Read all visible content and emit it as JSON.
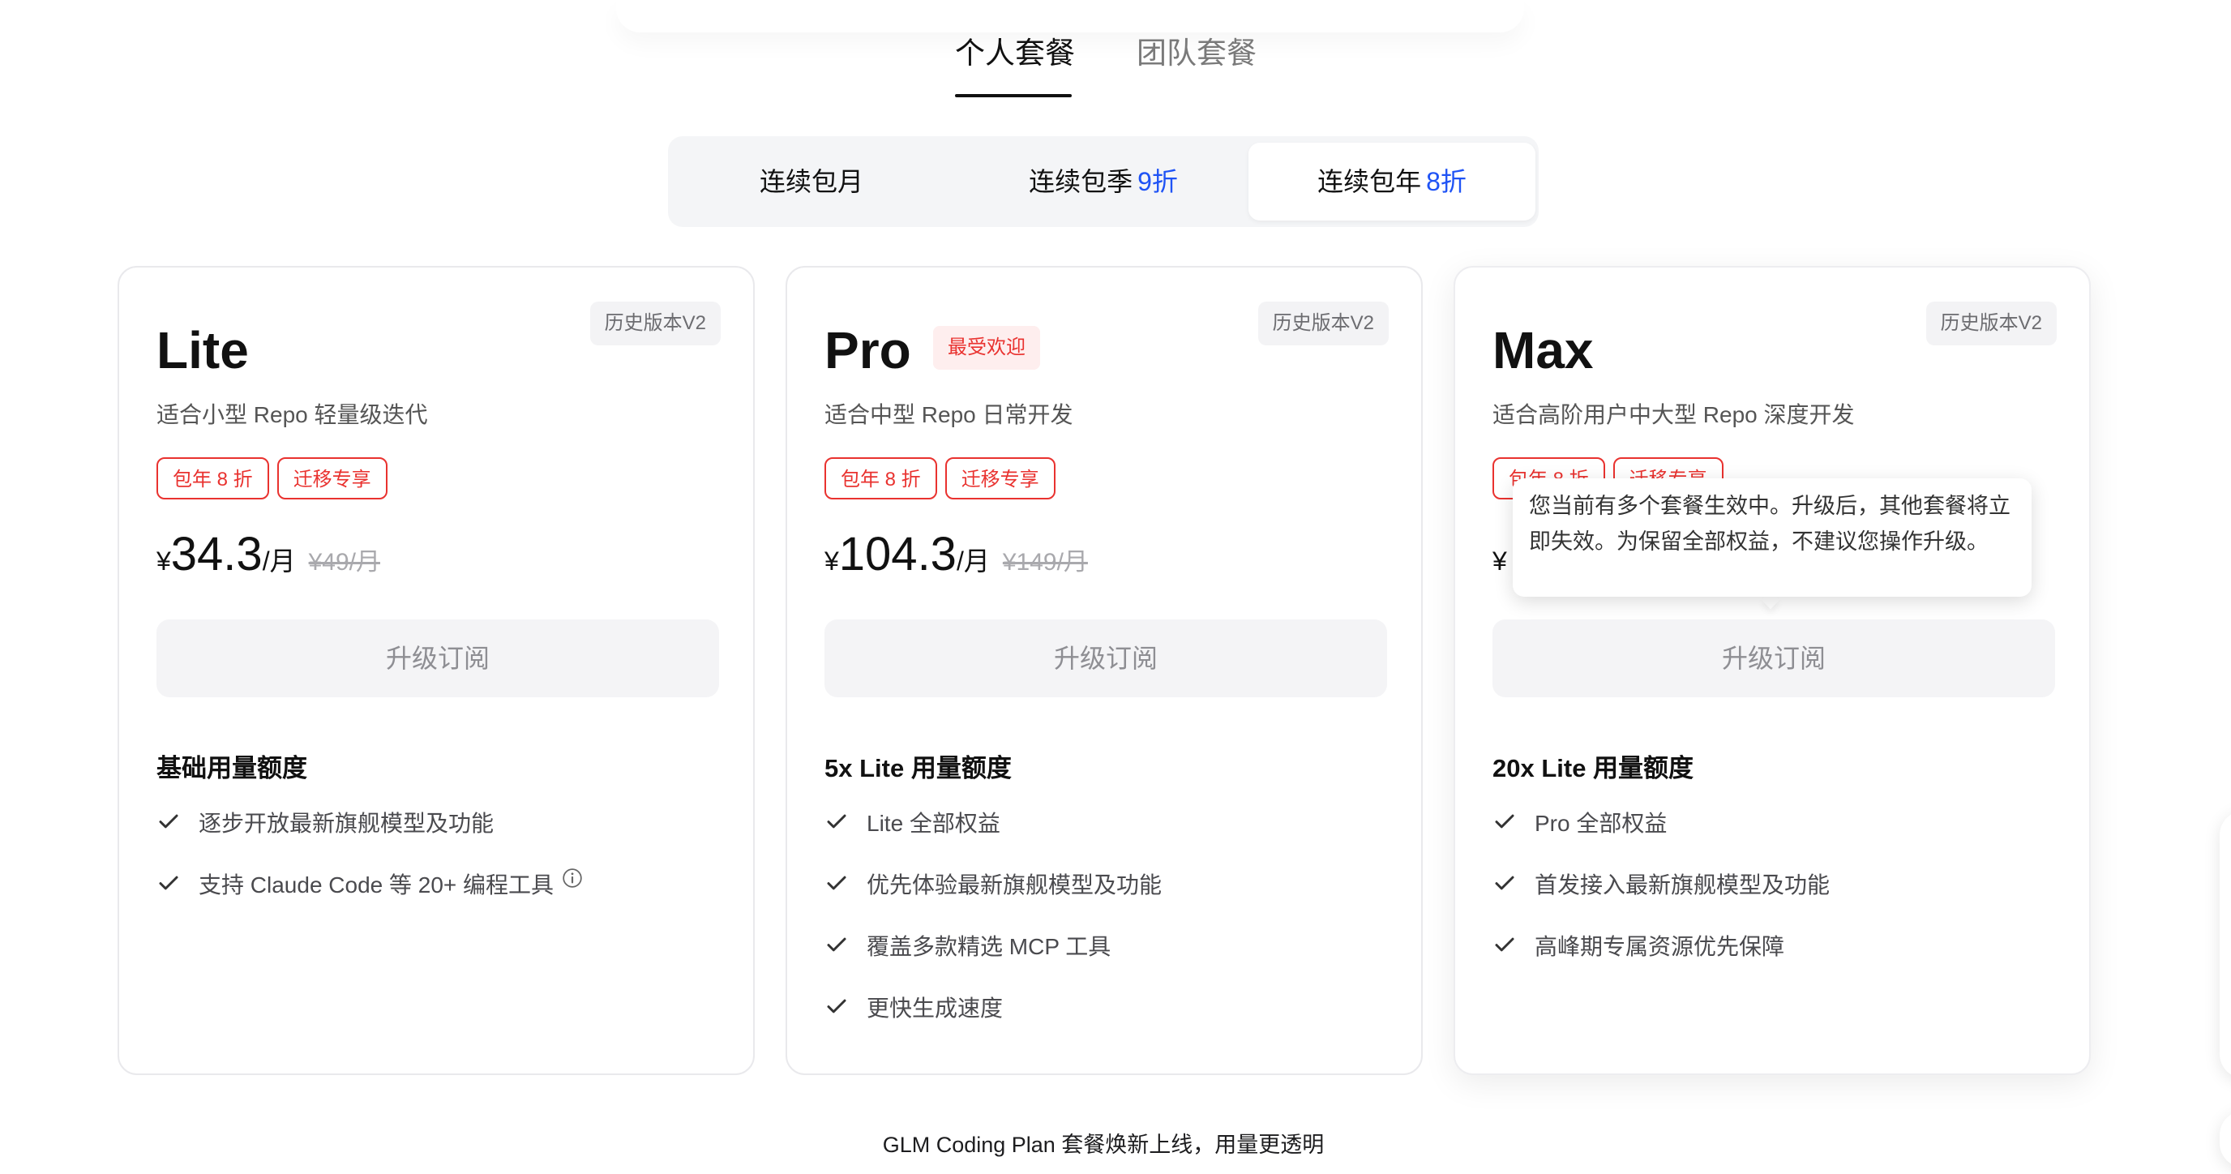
{
  "tabs": [
    {
      "label": "个人套餐",
      "active": true
    },
    {
      "label": "团队套餐",
      "active": false
    }
  ],
  "billing": {
    "options": [
      {
        "label": "连续包月",
        "discount": ""
      },
      {
        "label": "连续包季",
        "discount": "9折"
      },
      {
        "label": "连续包年",
        "discount": "8折"
      }
    ],
    "selected": "连续包年",
    "accent_color": "#1f53f5"
  },
  "plans": [
    {
      "name": "Lite",
      "legacy_tag": "历史版本V2",
      "popular_tag": "",
      "description": "适合小型 Repo 轻量级迭代",
      "badges": [
        "包年 8 折",
        "迁移专享"
      ],
      "currency": "¥",
      "price": "34.3",
      "period": "/月",
      "original_price": "¥49/月",
      "button_label": "升级订阅",
      "quota_title": "基础用量额度",
      "features": [
        "逐步开放最新旗舰模型及功能",
        "支持 Claude Code 等 20+ 编程工具"
      ]
    },
    {
      "name": "Pro",
      "legacy_tag": "历史版本V2",
      "popular_tag": "最受欢迎",
      "description": "适合中型 Repo 日常开发",
      "badges": [
        "包年 8 折",
        "迁移专享"
      ],
      "currency": "¥",
      "price": "104.3",
      "period": "/月",
      "original_price": "¥149/月",
      "button_label": "升级订阅",
      "quota_title": "5x Lite 用量额度",
      "features": [
        "Lite 全部权益",
        "优先体验最新旗舰模型及功能",
        "覆盖多款精选 MCP 工具",
        "更快生成速度"
      ]
    },
    {
      "name": "Max",
      "legacy_tag": "历史版本V2",
      "popular_tag": "",
      "description": "适合高阶用户中大型 Repo 深度开发",
      "badges": [
        "包年 8 折",
        "迁移专享"
      ],
      "currency": "¥",
      "price": "",
      "period": "",
      "original_price": "",
      "button_label": "升级订阅",
      "quota_title": "20x Lite 用量额度",
      "features": [
        "Pro 全部权益",
        "首发接入最新旗舰模型及功能",
        "高峰期专属资源优先保障"
      ]
    }
  ],
  "tooltip": {
    "text": "您当前有多个套餐生效中。升级后，其他套餐将立即失效。为保留全部权益，不建议您操作升级。"
  },
  "footer": {
    "note": "GLM Coding Plan 套餐焕新上线，用量更透明"
  },
  "colors": {
    "badge_red": "#e9322f",
    "text_primary": "#111111",
    "button_bg": "#f4f4f6"
  },
  "icons": {
    "feature": "check-icon",
    "info": "info-icon"
  }
}
